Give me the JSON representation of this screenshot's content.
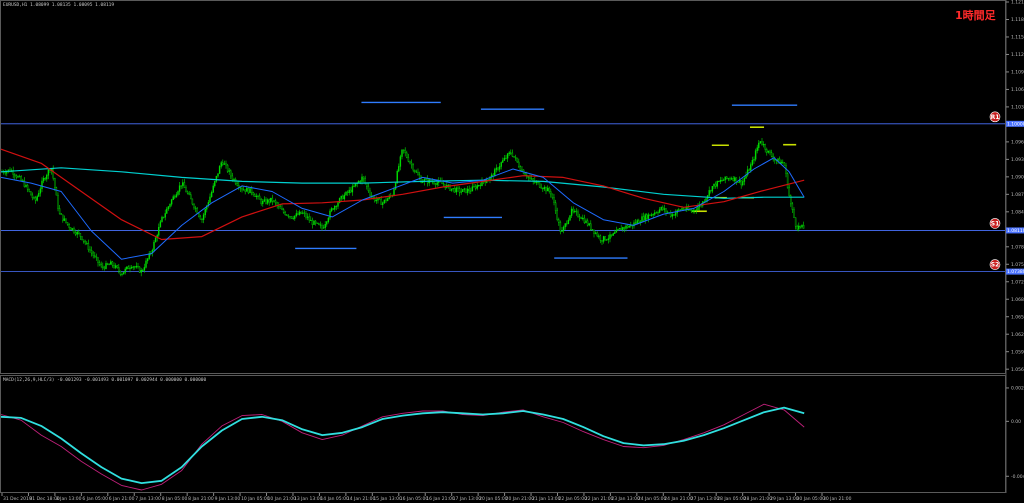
{
  "chart_data": {
    "type": "line",
    "symbol_header": "EURUSD,H1  1.08099 1.08135 1.08095 1.08119",
    "timeframe_label": "1時間足",
    "price_axis": {
      "ylim": [
        1.056,
        1.1216
      ],
      "ticks": [
        "1.12160",
        "1.11850",
        "1.11540",
        "1.11230",
        "1.10920",
        "1.10610",
        "1.10300",
        "1.09990",
        "1.09680",
        "1.09370",
        "1.09060",
        "1.08750",
        "1.08440",
        "1.08130",
        "1.07820",
        "1.07510",
        "1.07200",
        "1.06890",
        "1.06580",
        "1.06270",
        "1.05960",
        "1.05650"
      ]
    },
    "x_labels": [
      "31 Dec 2019",
      "31 Dec 18:00",
      "3 Jan 13:00",
      "6 Jan 05:00",
      "6 Jan 21:00",
      "7 Jan 13:00",
      "8 Jan 05:00",
      "8 Jan 21:00",
      "9 Jan 13:00",
      "10 Jan 05:00",
      "10 Jan 21:00",
      "13 Jan 13:00",
      "14 Jan 05:00",
      "14 Jan 21:00",
      "15 Jan 13:00",
      "16 Jan 05:00",
      "16 Jan 21:00",
      "17 Jan 13:00",
      "20 Jan 05:00",
      "20 Jan 21:00",
      "21 Jan 13:00",
      "22 Jan 05:00",
      "22 Jan 21:00",
      "23 Jan 13:00",
      "24 Jan 05:00",
      "24 Jan 21:00",
      "27 Jan 13:00",
      "28 Jan 05:00",
      "28 Jan 21:00",
      "29 Jan 13:00",
      "30 Jan 05:00",
      "30 Jan 21:00"
    ],
    "horizontal_levels": [
      {
        "badge": "R1",
        "price": 1.1,
        "color": "#4a72ff"
      },
      {
        "badge": "S1",
        "price": 1.0811,
        "color": "#4a72ff"
      },
      {
        "badge": "S2",
        "price": 1.0738,
        "color": "#4a72ff"
      }
    ],
    "level_labels": [
      "1.10000",
      "1.08110",
      "1.07380"
    ],
    "current_price": "1.08119",
    "colors": {
      "up_candle": "#00e000",
      "down_candle": "#00e000",
      "ma_fast": "#1e6bff",
      "ma_mid": "#d01010",
      "ma_slow": "#00d0d0",
      "swing_levels": "#2f7cff",
      "short_levels": "#c8e000",
      "level_line": "#4a72ff",
      "macd_main": "#30e0e0",
      "macd_signal": "#c0207a"
    },
    "swing_levels": [
      {
        "x0": 0.293,
        "x1": 0.354,
        "price": 1.0779
      },
      {
        "x0": 0.359,
        "x1": 0.438,
        "price": 1.1038
      },
      {
        "x0": 0.441,
        "x1": 0.499,
        "price": 1.0834
      },
      {
        "x0": 0.478,
        "x1": 0.541,
        "price": 1.1026
      },
      {
        "x0": 0.551,
        "x1": 0.624,
        "price": 1.0762
      },
      {
        "x0": 0.728,
        "x1": 0.793,
        "price": 1.1033
      }
    ],
    "short_levels": [
      {
        "x0": 0.688,
        "x1": 0.703,
        "price": 1.0845
      },
      {
        "x0": 0.708,
        "x1": 0.725,
        "price": 1.0962
      },
      {
        "x0": 0.711,
        "x1": 0.723,
        "price": 1.0869
      },
      {
        "x0": 0.734,
        "x1": 0.75,
        "price": 1.0869
      },
      {
        "x0": 0.746,
        "x1": 0.76,
        "price": 1.0994
      },
      {
        "x0": 0.779,
        "x1": 0.792,
        "price": 1.0963
      }
    ],
    "price_series": [
      [
        0.0,
        1.0915
      ],
      [
        0.01,
        1.0918
      ],
      [
        0.022,
        1.0896
      ],
      [
        0.034,
        1.0862
      ],
      [
        0.042,
        1.09
      ],
      [
        0.05,
        1.0925
      ],
      [
        0.058,
        1.084
      ],
      [
        0.068,
        1.0818
      ],
      [
        0.08,
        1.08
      ],
      [
        0.09,
        1.0772
      ],
      [
        0.1,
        1.0745
      ],
      [
        0.11,
        1.0752
      ],
      [
        0.12,
        1.0735
      ],
      [
        0.13,
        1.075
      ],
      [
        0.14,
        1.0738
      ],
      [
        0.15,
        1.0775
      ],
      [
        0.16,
        1.083
      ],
      [
        0.17,
        1.0865
      ],
      [
        0.18,
        1.0895
      ],
      [
        0.19,
        1.0862
      ],
      [
        0.2,
        1.083
      ],
      [
        0.21,
        1.088
      ],
      [
        0.22,
        1.0935
      ],
      [
        0.23,
        1.0905
      ],
      [
        0.24,
        1.0885
      ],
      [
        0.25,
        1.088
      ],
      [
        0.26,
        1.086
      ],
      [
        0.27,
        1.0865
      ],
      [
        0.28,
        1.0845
      ],
      [
        0.29,
        1.0835
      ],
      [
        0.3,
        1.0842
      ],
      [
        0.31,
        1.0825
      ],
      [
        0.32,
        1.0815
      ],
      [
        0.33,
        1.085
      ],
      [
        0.34,
        1.087
      ],
      [
        0.35,
        1.0885
      ],
      [
        0.36,
        1.0905
      ],
      [
        0.37,
        1.0868
      ],
      [
        0.38,
        1.086
      ],
      [
        0.39,
        1.0875
      ],
      [
        0.4,
        1.0955
      ],
      [
        0.408,
        1.093
      ],
      [
        0.418,
        1.09
      ],
      [
        0.428,
        1.0898
      ],
      [
        0.438,
        1.0895
      ],
      [
        0.448,
        1.0885
      ],
      [
        0.458,
        1.088
      ],
      [
        0.468,
        1.0883
      ],
      [
        0.478,
        1.0895
      ],
      [
        0.488,
        1.0905
      ],
      [
        0.498,
        1.093
      ],
      [
        0.508,
        1.095
      ],
      [
        0.518,
        1.092
      ],
      [
        0.528,
        1.09
      ],
      [
        0.538,
        1.089
      ],
      [
        0.548,
        1.0878
      ],
      [
        0.558,
        1.0805
      ],
      [
        0.568,
        1.0845
      ],
      [
        0.578,
        1.0835
      ],
      [
        0.588,
        1.0815
      ],
      [
        0.598,
        1.0795
      ],
      [
        0.608,
        1.08
      ],
      [
        0.618,
        1.0815
      ],
      [
        0.628,
        1.082
      ],
      [
        0.638,
        1.0832
      ],
      [
        0.648,
        1.084
      ],
      [
        0.658,
        1.085
      ],
      [
        0.668,
        1.0838
      ],
      [
        0.678,
        1.085
      ],
      [
        0.688,
        1.0845
      ],
      [
        0.698,
        1.0858
      ],
      [
        0.708,
        1.0888
      ],
      [
        0.718,
        1.09
      ],
      [
        0.728,
        1.0905
      ],
      [
        0.738,
        1.0895
      ],
      [
        0.748,
        1.093
      ],
      [
        0.756,
        1.0972
      ],
      [
        0.764,
        1.095
      ],
      [
        0.772,
        1.0935
      ],
      [
        0.78,
        1.093
      ],
      [
        0.786,
        1.0862
      ],
      [
        0.792,
        1.0818
      ],
      [
        0.8,
        1.0815
      ]
    ],
    "ma_fast_series": [
      [
        0.0,
        1.0905
      ],
      [
        0.03,
        1.0895
      ],
      [
        0.06,
        1.088
      ],
      [
        0.09,
        1.081
      ],
      [
        0.12,
        1.076
      ],
      [
        0.15,
        1.077
      ],
      [
        0.18,
        1.082
      ],
      [
        0.21,
        1.086
      ],
      [
        0.24,
        1.089
      ],
      [
        0.27,
        1.088
      ],
      [
        0.3,
        1.085
      ],
      [
        0.33,
        1.0835
      ],
      [
        0.36,
        1.0865
      ],
      [
        0.39,
        1.0885
      ],
      [
        0.42,
        1.0905
      ],
      [
        0.45,
        1.0895
      ],
      [
        0.48,
        1.09
      ],
      [
        0.51,
        1.092
      ],
      [
        0.54,
        1.0905
      ],
      [
        0.57,
        1.086
      ],
      [
        0.6,
        1.083
      ],
      [
        0.63,
        1.082
      ],
      [
        0.66,
        1.084
      ],
      [
        0.69,
        1.085
      ],
      [
        0.72,
        1.088
      ],
      [
        0.75,
        1.092
      ],
      [
        0.77,
        1.094
      ],
      [
        0.785,
        1.0915
      ],
      [
        0.8,
        1.087
      ]
    ],
    "ma_mid_series": [
      [
        0.0,
        1.0955
      ],
      [
        0.04,
        1.093
      ],
      [
        0.08,
        1.088
      ],
      [
        0.12,
        1.083
      ],
      [
        0.16,
        1.0795
      ],
      [
        0.2,
        1.08
      ],
      [
        0.24,
        1.0835
      ],
      [
        0.28,
        1.0858
      ],
      [
        0.32,
        1.086
      ],
      [
        0.36,
        1.0865
      ],
      [
        0.4,
        1.0875
      ],
      [
        0.44,
        1.0888
      ],
      [
        0.48,
        1.0898
      ],
      [
        0.52,
        1.0908
      ],
      [
        0.56,
        1.0905
      ],
      [
        0.6,
        1.089
      ],
      [
        0.64,
        1.0868
      ],
      [
        0.68,
        1.0852
      ],
      [
        0.72,
        1.0862
      ],
      [
        0.76,
        1.0882
      ],
      [
        0.8,
        1.09
      ]
    ],
    "ma_slow_series": [
      [
        0.0,
        1.0915
      ],
      [
        0.06,
        1.0922
      ],
      [
        0.12,
        1.0915
      ],
      [
        0.18,
        1.0905
      ],
      [
        0.24,
        1.0898
      ],
      [
        0.3,
        1.0895
      ],
      [
        0.36,
        1.0895
      ],
      [
        0.42,
        1.0898
      ],
      [
        0.48,
        1.09
      ],
      [
        0.54,
        1.0898
      ],
      [
        0.6,
        1.0888
      ],
      [
        0.66,
        1.0875
      ],
      [
        0.72,
        1.0868
      ],
      [
        0.76,
        1.087
      ],
      [
        0.8,
        1.087
      ]
    ],
    "macd": {
      "header": "MACD(12,26,9,HLC/3) -0.001293 -0.001493 0.001097 0.002944 0.000000 0.000000",
      "ylim": [
        -0.006,
        0.003
      ],
      "ticks": [
        "0.002917",
        "0.00",
        "-0.004800"
      ],
      "main": [
        [
          0.0,
          0.0004
        ],
        [
          0.02,
          0.0003
        ],
        [
          0.04,
          -0.0004
        ],
        [
          0.06,
          -0.0015
        ],
        [
          0.08,
          -0.0028
        ],
        [
          0.1,
          -0.004
        ],
        [
          0.12,
          -0.005
        ],
        [
          0.14,
          -0.0054
        ],
        [
          0.16,
          -0.0052
        ],
        [
          0.18,
          -0.004
        ],
        [
          0.2,
          -0.0022
        ],
        [
          0.22,
          -0.0008
        ],
        [
          0.24,
          0.0002
        ],
        [
          0.26,
          0.0004
        ],
        [
          0.28,
          0.0001
        ],
        [
          0.3,
          -0.0007
        ],
        [
          0.32,
          -0.0012
        ],
        [
          0.34,
          -0.001
        ],
        [
          0.36,
          -0.0005
        ],
        [
          0.38,
          0.0002
        ],
        [
          0.4,
          0.0005
        ],
        [
          0.42,
          0.0007
        ],
        [
          0.44,
          0.0008
        ],
        [
          0.46,
          0.0007
        ],
        [
          0.48,
          0.0006
        ],
        [
          0.5,
          0.0007
        ],
        [
          0.52,
          0.0009
        ],
        [
          0.54,
          0.0006
        ],
        [
          0.56,
          0.0002
        ],
        [
          0.58,
          -0.0005
        ],
        [
          0.6,
          -0.0013
        ],
        [
          0.62,
          -0.0019
        ],
        [
          0.64,
          -0.0021
        ],
        [
          0.66,
          -0.002
        ],
        [
          0.68,
          -0.0017
        ],
        [
          0.7,
          -0.0012
        ],
        [
          0.72,
          -0.0006
        ],
        [
          0.74,
          0.0001
        ],
        [
          0.76,
          0.0008
        ],
        [
          0.78,
          0.0012
        ],
        [
          0.8,
          0.0007
        ]
      ],
      "signal": [
        [
          0.0,
          0.0006
        ],
        [
          0.02,
          0.0001
        ],
        [
          0.04,
          -0.0012
        ],
        [
          0.06,
          -0.0022
        ],
        [
          0.08,
          -0.0035
        ],
        [
          0.1,
          -0.0046
        ],
        [
          0.12,
          -0.0056
        ],
        [
          0.14,
          -0.006
        ],
        [
          0.16,
          -0.0055
        ],
        [
          0.18,
          -0.0043
        ],
        [
          0.2,
          -0.002
        ],
        [
          0.22,
          -0.0004
        ],
        [
          0.24,
          0.0005
        ],
        [
          0.26,
          0.0006
        ],
        [
          0.28,
          0.0
        ],
        [
          0.3,
          -0.001
        ],
        [
          0.32,
          -0.0016
        ],
        [
          0.34,
          -0.0012
        ],
        [
          0.36,
          -0.0004
        ],
        [
          0.38,
          0.0004
        ],
        [
          0.4,
          0.0007
        ],
        [
          0.42,
          0.0009
        ],
        [
          0.44,
          0.0009
        ],
        [
          0.46,
          0.0006
        ],
        [
          0.48,
          0.0005
        ],
        [
          0.5,
          0.0008
        ],
        [
          0.52,
          0.001
        ],
        [
          0.54,
          0.0004
        ],
        [
          0.56,
          -0.0001
        ],
        [
          0.58,
          -0.0009
        ],
        [
          0.6,
          -0.0016
        ],
        [
          0.62,
          -0.0022
        ],
        [
          0.64,
          -0.0023
        ],
        [
          0.66,
          -0.0021
        ],
        [
          0.68,
          -0.0016
        ],
        [
          0.7,
          -0.001
        ],
        [
          0.72,
          -0.0003
        ],
        [
          0.74,
          0.0006
        ],
        [
          0.76,
          0.0015
        ],
        [
          0.78,
          0.001
        ],
        [
          0.8,
          -0.0005
        ]
      ]
    }
  }
}
